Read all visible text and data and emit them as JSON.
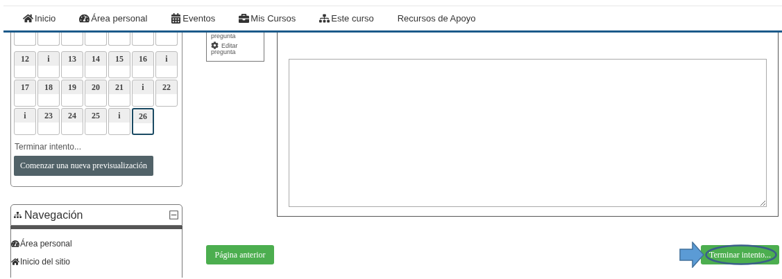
{
  "top_nav": [
    {
      "label": "Inicio"
    },
    {
      "label": "Área personal"
    },
    {
      "label": "Eventos"
    },
    {
      "label": "Mis Cursos"
    },
    {
      "label": "Este curso"
    },
    {
      "label": "Recursos de Apoyo"
    }
  ],
  "quiz_navigation": {
    "cells": [
      {
        "label": "12",
        "selected": false
      },
      {
        "label": "i",
        "selected": false
      },
      {
        "label": "13",
        "selected": false
      },
      {
        "label": "14",
        "selected": false
      },
      {
        "label": "15",
        "selected": false
      },
      {
        "label": "16",
        "selected": false
      },
      {
        "label": "i",
        "selected": false
      },
      {
        "label": "17",
        "selected": false
      },
      {
        "label": "18",
        "selected": false
      },
      {
        "label": "19",
        "selected": false
      },
      {
        "label": "20",
        "selected": false
      },
      {
        "label": "21",
        "selected": false
      },
      {
        "label": "i",
        "selected": false
      },
      {
        "label": "22",
        "selected": false
      },
      {
        "label": "i",
        "selected": false
      },
      {
        "label": "23",
        "selected": false
      },
      {
        "label": "24",
        "selected": false
      },
      {
        "label": "25",
        "selected": false
      },
      {
        "label": "i",
        "selected": false
      },
      {
        "label": "26",
        "selected": true
      }
    ],
    "finish_link": "Terminar intento...",
    "restart_button": "Comenzar una nueva previsualización"
  },
  "navigation_block": {
    "title": "Navegación",
    "items": [
      "Área personal",
      "Inicio del sitio"
    ]
  },
  "question_info": {
    "cut_text": "pregunta",
    "edit_link": "Editar pregunta"
  },
  "buttons": {
    "previous": "Página anterior",
    "finish": "Terminar intento..."
  }
}
